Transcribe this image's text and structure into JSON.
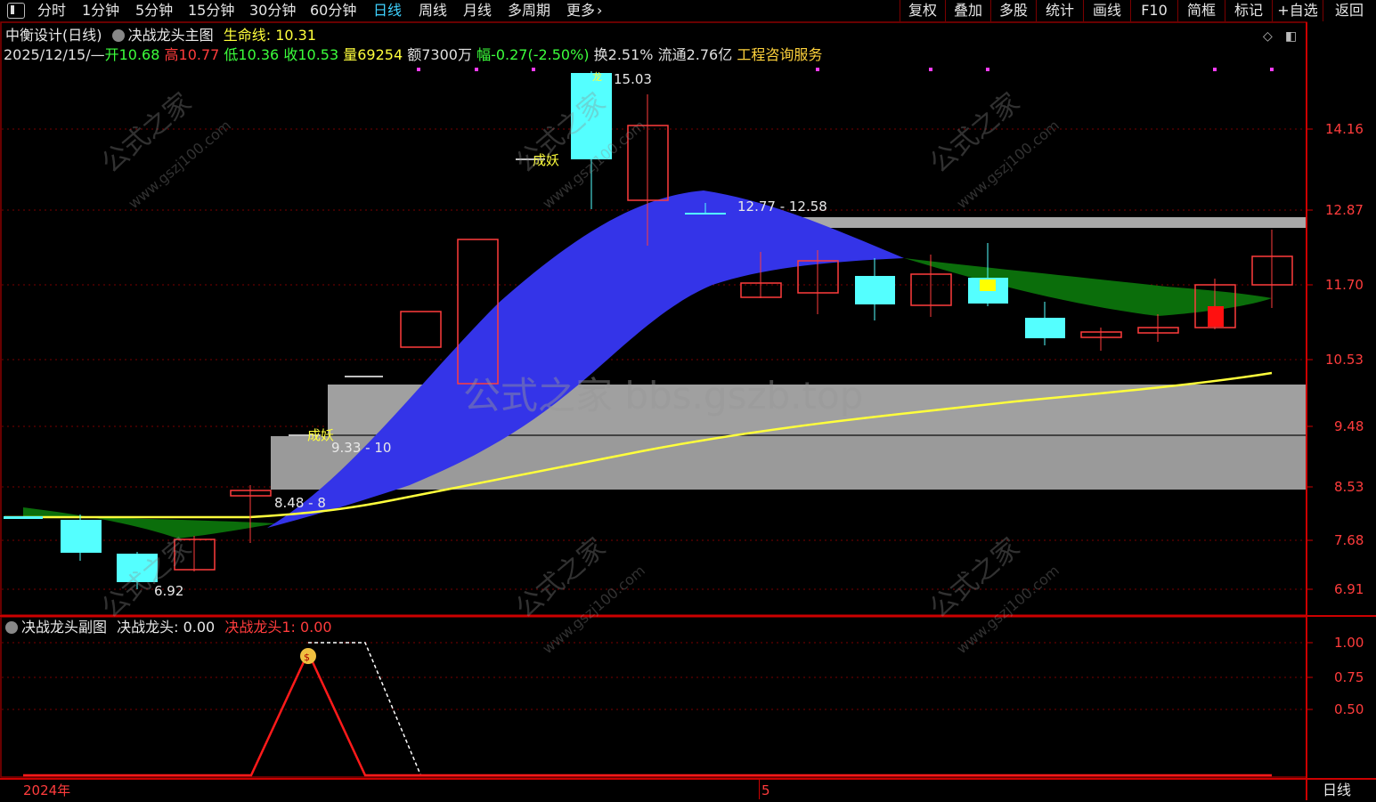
{
  "toolbar": {
    "periods": [
      "分时",
      "1分钟",
      "5分钟",
      "15分钟",
      "30分钟",
      "60分钟",
      "日线",
      "周线",
      "月线",
      "多周期",
      "更多"
    ],
    "active_period": "日线",
    "more_chevron": "›",
    "right_buttons": [
      "复权",
      "叠加",
      "多股",
      "统计",
      "画线",
      "F10",
      "简框",
      "标记",
      "+自选",
      "返回"
    ]
  },
  "main_panel": {
    "stock_name": "中衡设计(日线)",
    "indicator_name": "决战龙头主图",
    "lifeline_label": "生命线:",
    "lifeline_value": "10.31",
    "info_date": "2025/12/15/—",
    "info_open": "开10.68",
    "info_high": "高10.77",
    "info_low": "低10.36",
    "info_close": "收10.53",
    "info_volume": "量69254",
    "info_amount": "额7300万",
    "info_change": "幅-0.27(-2.50%)",
    "info_turnover": "换2.51%",
    "info_float": "流通2.76亿",
    "info_sector": "工程咨询服务",
    "price_axis": [
      "14.16",
      "12.87",
      "11.70",
      "10.53",
      "9.48",
      "8.53",
      "7.68",
      "6.91"
    ],
    "annotations": {
      "high_price": "15.03",
      "low_price": "6.92",
      "range_upper": "12.77 - 12.58",
      "range_mid": "9.33 - 10",
      "range_low": "8.48 - 8",
      "tag_chengyao_1": "成妖",
      "tag_chengyao_2": "成妖",
      "tag_marker": "龙"
    },
    "watermark_center": "公式之家 bbs.gszb.top",
    "watermark_repeat": "公式之家",
    "watermark_url": "www.gszj100.com"
  },
  "sub_panel": {
    "indicator_name": "决战龙头副图",
    "line1_label": "决战龙头: 0.00",
    "line2_label": "决战龙头1: 0.00",
    "axis": [
      "1.00",
      "0.75",
      "0.50"
    ],
    "signal_icon": "money-bag-icon"
  },
  "time_axis": {
    "year_label": "2024年",
    "month_label": "5",
    "period_label": "日线"
  },
  "colors": {
    "up": "#ff3c3c",
    "down": "#54ffff",
    "lifeline": "#ffff3c",
    "band_blue": "#3a3ae8",
    "band_green": "#0b6e0b",
    "zone_gray": "#9a9a9a",
    "grid": "#7a0000"
  }
}
